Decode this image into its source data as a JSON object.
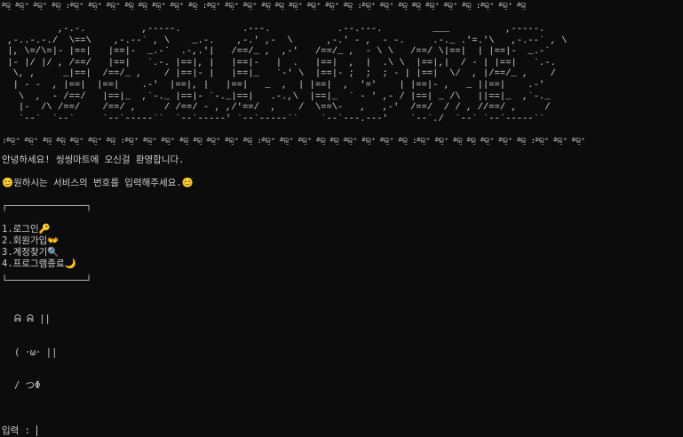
{
  "decoration": {
    "top_border": "࿔ଳ̮ ࿔ଳ̮⁺ ࿔ଳ̮⁺ ࿔ଳ̮ :࿔ଳ̮⁺ ࿔ଳ̮⁺ ࿔ଳ̮⁺ ࿔ଳ̮ ࿔ଳ̮ ࿔ଳ̮⁺ ࿔ଳ̮⁺ ࿔ଳ̮ :࿔ଳ̮⁺ ࿔ଳ̮⁺ ࿔ଳ̮⁺ ࿔ଳ̮ ࿔ଳ̮ ࿔ଳ̮⁺ ࿔ଳ̮⁺ ࿔ଳ̮⁺ ࿔ଳ̮ :࿔ଳ̮⁺ ࿔ଳ̮⁺ ࿔ଳ̮ ࿔ଳ̮ ࿔ଳ̮⁺ ࿔ଳ̮⁺ ࿔ଳ̮ :࿔ଳ̮⁺ ࿔ଳ̮⁺ ࿔ଳ̮",
    "bottom_border": ":࿔ଳ̮⁺ ࿔ଳ̮⁺ ࿔ଳ̮ ࿔ଳ̮ ࿔ଳ̮⁺ ࿔ଳ̮⁺ ࿔ଳ̮ :࿔ଳ̮⁺ ࿔ଳ̮⁺ ࿔ଳ̮⁺ ࿔ଳ̮ ࿔ଳ̮ ࿔ଳ̮⁺ ࿔ଳ̮⁺ ࿔ଳ̮ :࿔ଳ̮⁺ ࿔ଳ̮⁺ ࿔ଳ̮⁺ ࿔ଳ̮ ࿔ଳ̮ ࿔ଳ̮⁺ ࿔ଳ̮⁺ ࿔ଳ̮⁺ ࿔ଳ̮ :࿔ଳ̮⁺ ࿔ଳ̮⁺ ࿔ଳ̮ ࿔ଳ̮ ࿔ଳ̮⁺ ࿔ଳ̮⁺ ࿔ଳ̮ :࿔ଳ̮⁺ ࿔ଳ̮⁺ ࿔ଳ̮⁺"
  },
  "banner": {
    "lines": [
      "          ,-.-.          ,-----.           .---.            .--.---.         ___          ,-----.    ",
      " ,-..-.-./  \\==\\    ,-.--` , \\    _.-.    ,-.' ,-  \\      ,-.' - ,  - -.     .-._ .'=.'\\   ,-.--` , \\   ",
      " |, \\=/\\=|- |==|   |==|-  _.-`  .-,.'|   /==/_ ,  ,-'   /==/_ ,  - \\ \\   /==/ \\|==|  | |==|-  _.-`   ",
      " |- |/ |/ , /==/   |==|   `.-. |==|, |   |==|-   |  .   |==|  ,  |  .\\ \\  |==|,|  / - | |==|   `.-.   ",
      "  \\, ,     _|==|  /==/_ ,    / |==|- |   |==|_   `-' \\  |==|- ;  ;  ; - | |==|  \\/  , |/==/_ ,    /   ",
      "  | - -  , |==|  |==|    .-'  |==|, |   |==|   _  ,  | |==|  ,  '='    | |==|- ,   _ ||==|    .-'    ",
      "   \\  ,  - /==/   |==|_  ,`-._ |==|- `-._|==|   .-.,\\  |==|_  ` - ' ,- / |==| _ /\\   ||==|_  ,`-._   ",
      "   |-  /\\ /==/    /==/ ,     / /==/ - , ,/'==/  ,    /  \\==\\-   ,   ,-'  /==/  / / , //==/ ,     /   ",
      "   `--`  `--`     `--`-----``  `--`-----' `--`-----``    `--`---.---'    `--`./  `--` `--`-----``    "
    ]
  },
  "greeting": "안녕하세요! 씽씽마트에 오신걸 환영합니다.",
  "instruction": "😊원하시는 서비스의 번호를 입력해주세요.😊",
  "menu": {
    "box_top": "┌──────────────┐",
    "box_bottom": "└──────────────┘",
    "items": [
      "1.로그인🔑",
      "2.회원가입👐",
      "3.계정찾기🔍",
      "4.프로그램종료🌙"
    ]
  },
  "bunny": [
    "ᕱ ᕱ ||",
    "( ･ω･ ||",
    "/ つΦ"
  ],
  "prompt": {
    "label": "입력 : "
  }
}
